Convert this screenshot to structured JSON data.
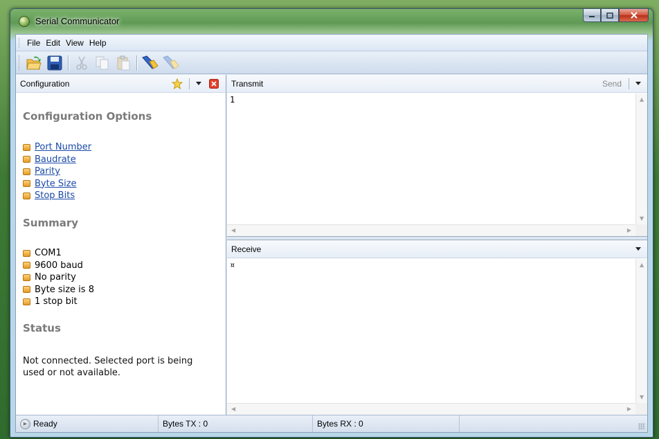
{
  "window": {
    "title": "Serial Communicator"
  },
  "menu": {
    "items": [
      "File",
      "Edit",
      "View",
      "Help"
    ]
  },
  "toolbar": {
    "buttons": [
      "open-folder-icon",
      "save-icon",
      "cut-icon",
      "copy-icon",
      "paste-icon",
      "connect-icon",
      "disconnect-icon"
    ]
  },
  "config_pane": {
    "header": "Configuration",
    "options_title": "Configuration Options",
    "options": [
      "Port Number",
      "Baudrate",
      "Parity",
      "Byte Size",
      "Stop Bits"
    ],
    "summary_title": "Summary",
    "summary": [
      "COM1",
      "9600 baud",
      "No parity",
      "Byte size is 8",
      "1 stop bit"
    ],
    "status_title": "Status",
    "status_text": "Not connected. Selected port is being used or not available."
  },
  "transmit": {
    "header": "Transmit",
    "send_label": "Send",
    "content": "1"
  },
  "receive": {
    "header": "Receive",
    "content": "¤"
  },
  "statusbar": {
    "ready": "Ready",
    "bytes_tx": "Bytes TX : 0",
    "bytes_rx": "Bytes RX : 0"
  },
  "colors": {
    "link": "#1a4aa8",
    "section_title": "#7a7a7a",
    "bullet": "#e59b24"
  }
}
